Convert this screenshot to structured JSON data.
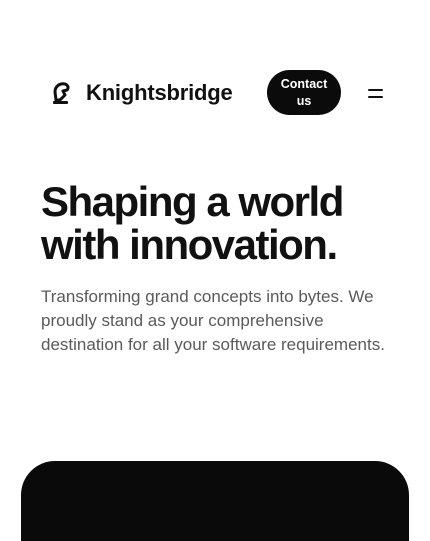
{
  "header": {
    "brand_name": "Knightsbridge",
    "contact_label": "Contact us",
    "logo_icon": "knight-chess-logo-icon",
    "menu_icon": "menu-icon"
  },
  "hero": {
    "title": "Shaping a world with innovation.",
    "description": "Transforming grand concepts into bytes. We proudly stand as your comprehensive destination for all your software requirements."
  },
  "colors": {
    "background": "#ffffff",
    "text_primary": "#111111",
    "text_secondary": "#5a5a5a",
    "button_background": "#0b0b0b",
    "button_text": "#ffffff",
    "panel_background": "#0a0a0a"
  }
}
